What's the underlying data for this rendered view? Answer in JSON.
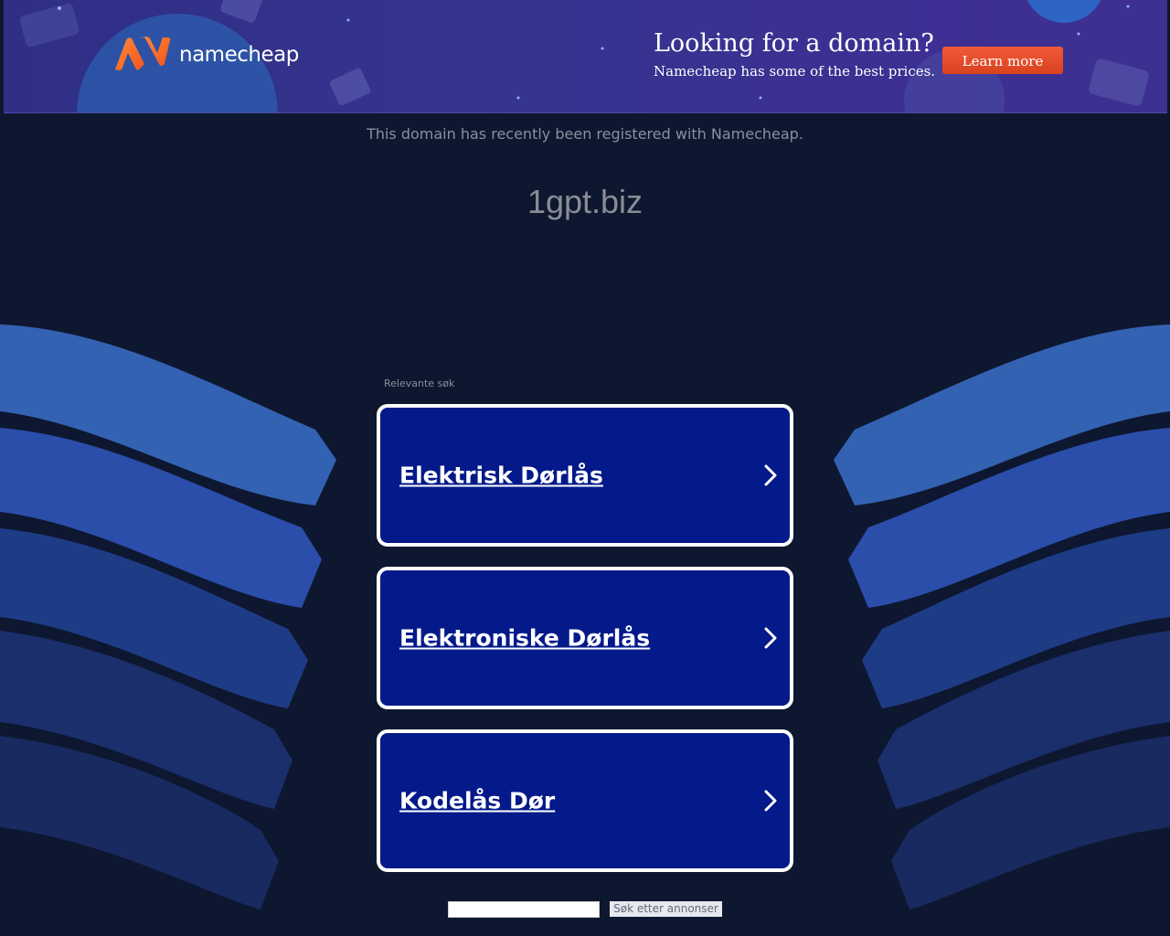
{
  "banner": {
    "logo_text": "namecheap",
    "logo_icon": "namecheap-n-logo-icon",
    "headline": "Looking for a domain?",
    "subline": "Namecheap has some of the best prices.",
    "cta_label": "Learn more",
    "cta_color": "#e84c2b",
    "logo_color": "#fd6a21"
  },
  "main": {
    "notice": "This domain has recently been registered with Namecheap.",
    "domain": "1gpt.biz",
    "related_label": "Relevante søk",
    "links": [
      {
        "label": "Elektrisk Dørlås"
      },
      {
        "label": "Elektroniske Dørlås"
      },
      {
        "label": "Kodelås Dør"
      }
    ],
    "card_color": "#041a8a",
    "chevron_icon": "chevron-right-icon"
  },
  "search": {
    "input_value": "",
    "button_label": "Søk etter annonser"
  }
}
